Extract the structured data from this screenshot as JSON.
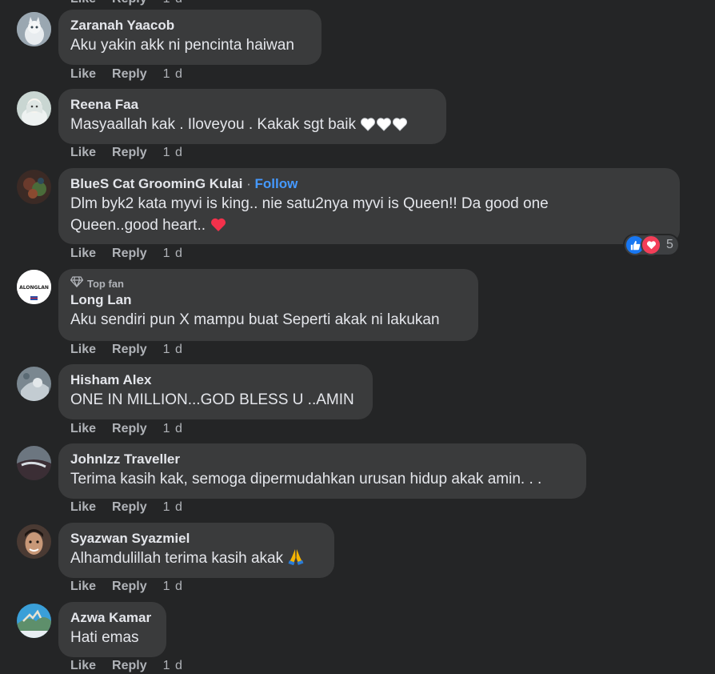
{
  "actions": {
    "like_label": "Like",
    "reply_label": "Reply"
  },
  "partial_top": {
    "like_label": "Like",
    "reply_label": "Reply",
    "time": "1 d"
  },
  "comments": [
    {
      "name": "Zaranah Yaacob",
      "text": "Aku yakin akk ni pencinta haiwan",
      "time": "1 d"
    },
    {
      "name": "Reena Faa",
      "text": "Masyaallah kak . Iloveyou . Kakak sgt baik",
      "emoji": [
        "white-heart",
        "white-heart",
        "white-heart"
      ],
      "time": "1 d"
    },
    {
      "name": "BlueS Cat GroominG Kulai",
      "separator": "·",
      "follow_label": "Follow",
      "text_line1": "Dlm byk2 kata myvi is king.. nie satu2nya myvi is Queen!! Da good one",
      "text_line2": "Queen..good heart..",
      "emoji": [
        "red-heart"
      ],
      "reactions": {
        "types": [
          "like-icon",
          "love-icon"
        ],
        "count": "5"
      },
      "time": "1 d"
    },
    {
      "badge": "Top fan",
      "name": "Long Lan",
      "text": "Aku sendiri pun X mampu buat Seperti akak ni lakukan",
      "avatar_text": "ALONGLAN",
      "time": "1 d"
    },
    {
      "name": "Hisham Alex",
      "text": "ONE IN MILLION...GOD BLESS U ..AMIN",
      "time": "1 d"
    },
    {
      "name": "JohnIzz Traveller",
      "text": "Terima kasih kak, semoga dipermudahkan urusan hidup akak amin. . .",
      "time": "1 d"
    },
    {
      "name": "Syazwan Syazmiel",
      "text": "Alhamdulillah terima kasih akak",
      "emoji": [
        "folded-hands"
      ],
      "time": "1 d"
    },
    {
      "name": "Azwa Kamar",
      "text": "Hati emas",
      "time": "1 d"
    }
  ],
  "colors": {
    "background": "#242526",
    "bubble": "#3a3b3c",
    "text": "#e4e6eb",
    "secondary": "#b0b3b8",
    "link": "#4599ff",
    "like": "#1877f2",
    "love": "#f33e58"
  }
}
